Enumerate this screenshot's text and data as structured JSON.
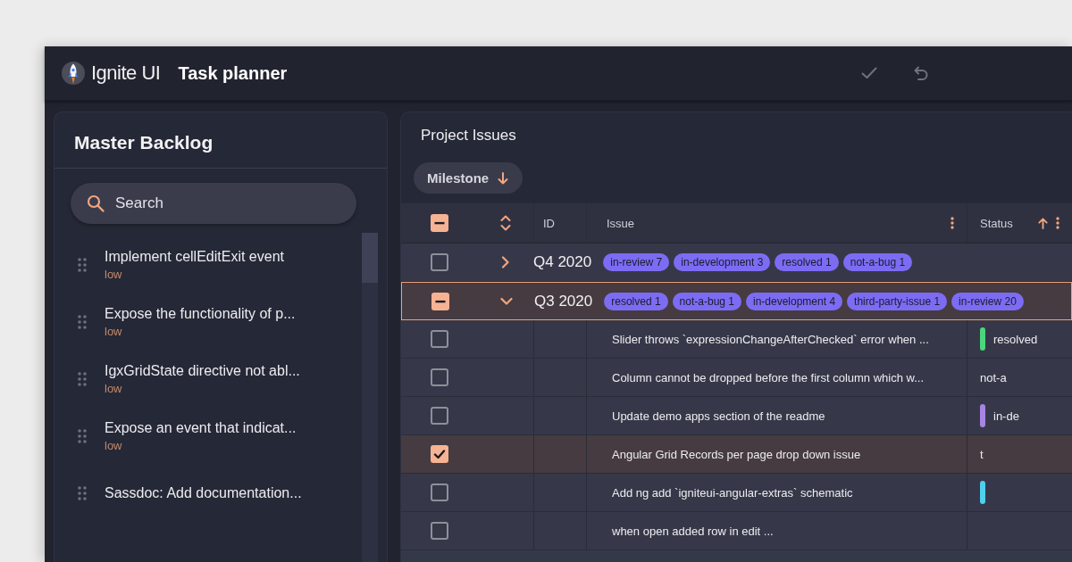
{
  "header": {
    "logo_text": "Ignite UI",
    "title": "Task planner"
  },
  "backlog": {
    "title": "Master Backlog",
    "search": {
      "placeholder": "Search"
    },
    "items": [
      {
        "title": "Implement cellEditExit event",
        "priority": "low"
      },
      {
        "title": "Expose the functionality of p...",
        "priority": "low"
      },
      {
        "title": "IgxGridState directive not abl...",
        "priority": "low"
      },
      {
        "title": "Expose an event that indicat...",
        "priority": "low"
      },
      {
        "title": "Sassdoc: Add documentation..."
      }
    ]
  },
  "issues": {
    "title": "Project Issues",
    "group_by": [
      {
        "label": "Milestone",
        "descending": true
      }
    ],
    "select_all": {
      "checked": false,
      "indeterminate": true
    },
    "columns": [
      {
        "label": "ID",
        "sorted": false,
        "menu": false
      },
      {
        "label": "Issue",
        "sorted": false,
        "menu": true
      },
      {
        "label": "Status",
        "sorted": true,
        "descending": false,
        "menu": true
      }
    ],
    "rows": [
      {
        "kind": "group",
        "label": "Q4 2020",
        "checked": false,
        "indeterminate": false,
        "expanded": false,
        "focused": false,
        "chips": [
          "in-review 7",
          "in-development 3",
          "resolved 1",
          "not-a-bug 1"
        ]
      },
      {
        "kind": "group",
        "label": "Q3 2020",
        "checked": false,
        "indeterminate": true,
        "expanded": true,
        "focused": true,
        "chips": [
          "resolved 1",
          "not-a-bug 1",
          "in-development 4",
          "third-party-issue 1",
          "in-review 20"
        ]
      },
      {
        "kind": "issue",
        "issue": "Slider throws `expressionChangeAfterChecked` error when ...",
        "selected": false,
        "status": {
          "text": "resolved",
          "color": "#4cd67c"
        }
      },
      {
        "kind": "issue",
        "issue": "Column cannot be dropped before the first column which w...",
        "selected": false,
        "status": {
          "text": "not-a"
        }
      },
      {
        "kind": "issue",
        "issue": "Update demo apps section of the readme",
        "selected": false,
        "status": {
          "text": "in-de",
          "color": "#a784e2"
        }
      },
      {
        "kind": "issue",
        "issue": "Angular Grid Records per page drop down issue",
        "selected": true,
        "status": {
          "text": "t"
        }
      },
      {
        "kind": "issue",
        "issue": "Add ng add `igniteui-angular-extras` schematic",
        "selected": false,
        "status": {
          "color": "#4fd0ec"
        }
      },
      {
        "kind": "issue",
        "issue": "when open added row in edit ...",
        "selected": false
      }
    ]
  }
}
